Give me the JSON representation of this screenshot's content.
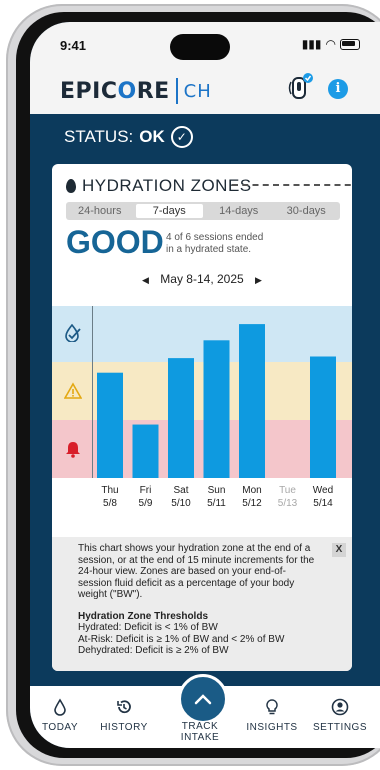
{
  "status_bar": {
    "time": "9:41"
  },
  "header": {
    "brand_left": "EPIC",
    "brand_o": "O",
    "brand_right": "RE",
    "brand_suffix": "CH",
    "info_label": "i"
  },
  "status": {
    "label": "STATUS:",
    "value": "OK"
  },
  "card": {
    "title": "HYDRATION ZONES",
    "tabs": [
      {
        "label": "24-hours",
        "active": false
      },
      {
        "label": "7-days",
        "active": true
      },
      {
        "label": "14-days",
        "active": false
      },
      {
        "label": "30-days",
        "active": false
      }
    ],
    "summary_value": "GOOD",
    "summary_desc_line1": "4 of 6 sessions ended",
    "summary_desc_line2": "in a hydrated state.",
    "date_prev": "◀",
    "date_range": "May 8-14, 2025",
    "date_next": "▶"
  },
  "chart_data": {
    "type": "bar",
    "zones": [
      "Hydrated",
      "At-Risk",
      "Dehydrated"
    ],
    "categories": [
      {
        "day": "Thu",
        "date": "5/8",
        "value": 0.65,
        "muted": false
      },
      {
        "day": "Fri",
        "date": "5/9",
        "value": 0.33,
        "muted": false
      },
      {
        "day": "Sat",
        "date": "5/10",
        "value": 0.74,
        "muted": false
      },
      {
        "day": "Sun",
        "date": "5/11",
        "value": 0.85,
        "muted": false
      },
      {
        "day": "Mon",
        "date": "5/12",
        "value": 0.95,
        "muted": false
      },
      {
        "day": "Tue",
        "date": "5/13",
        "value": null,
        "muted": true
      },
      {
        "day": "Wed",
        "date": "5/14",
        "value": 0.75,
        "muted": false
      }
    ],
    "bar_color": "#0e9ae0"
  },
  "info_panel": {
    "close_label": "X",
    "description": "This chart shows your hydration zone at the end of a session, or at the end of 15 minute increments for the 24-hour view. Zones are based on your end-of-session fluid deficit as a percentage of your body weight (\"BW\").",
    "thresholds_title": "Hydration Zone Thresholds",
    "hydrated": "Hydrated: Deficit is < 1% of BW",
    "at_risk": "At-Risk: Deficit is ≥ 1% of BW and < 2% of BW",
    "dehydrated": "Dehydrated: Deficit is ≥ 2% of BW"
  },
  "nav": {
    "today": "TODAY",
    "history": "HISTORY",
    "track_line1": "TRACK",
    "track_line2": "INTAKE",
    "insights": "INSIGHTS",
    "settings": "SETTINGS"
  }
}
